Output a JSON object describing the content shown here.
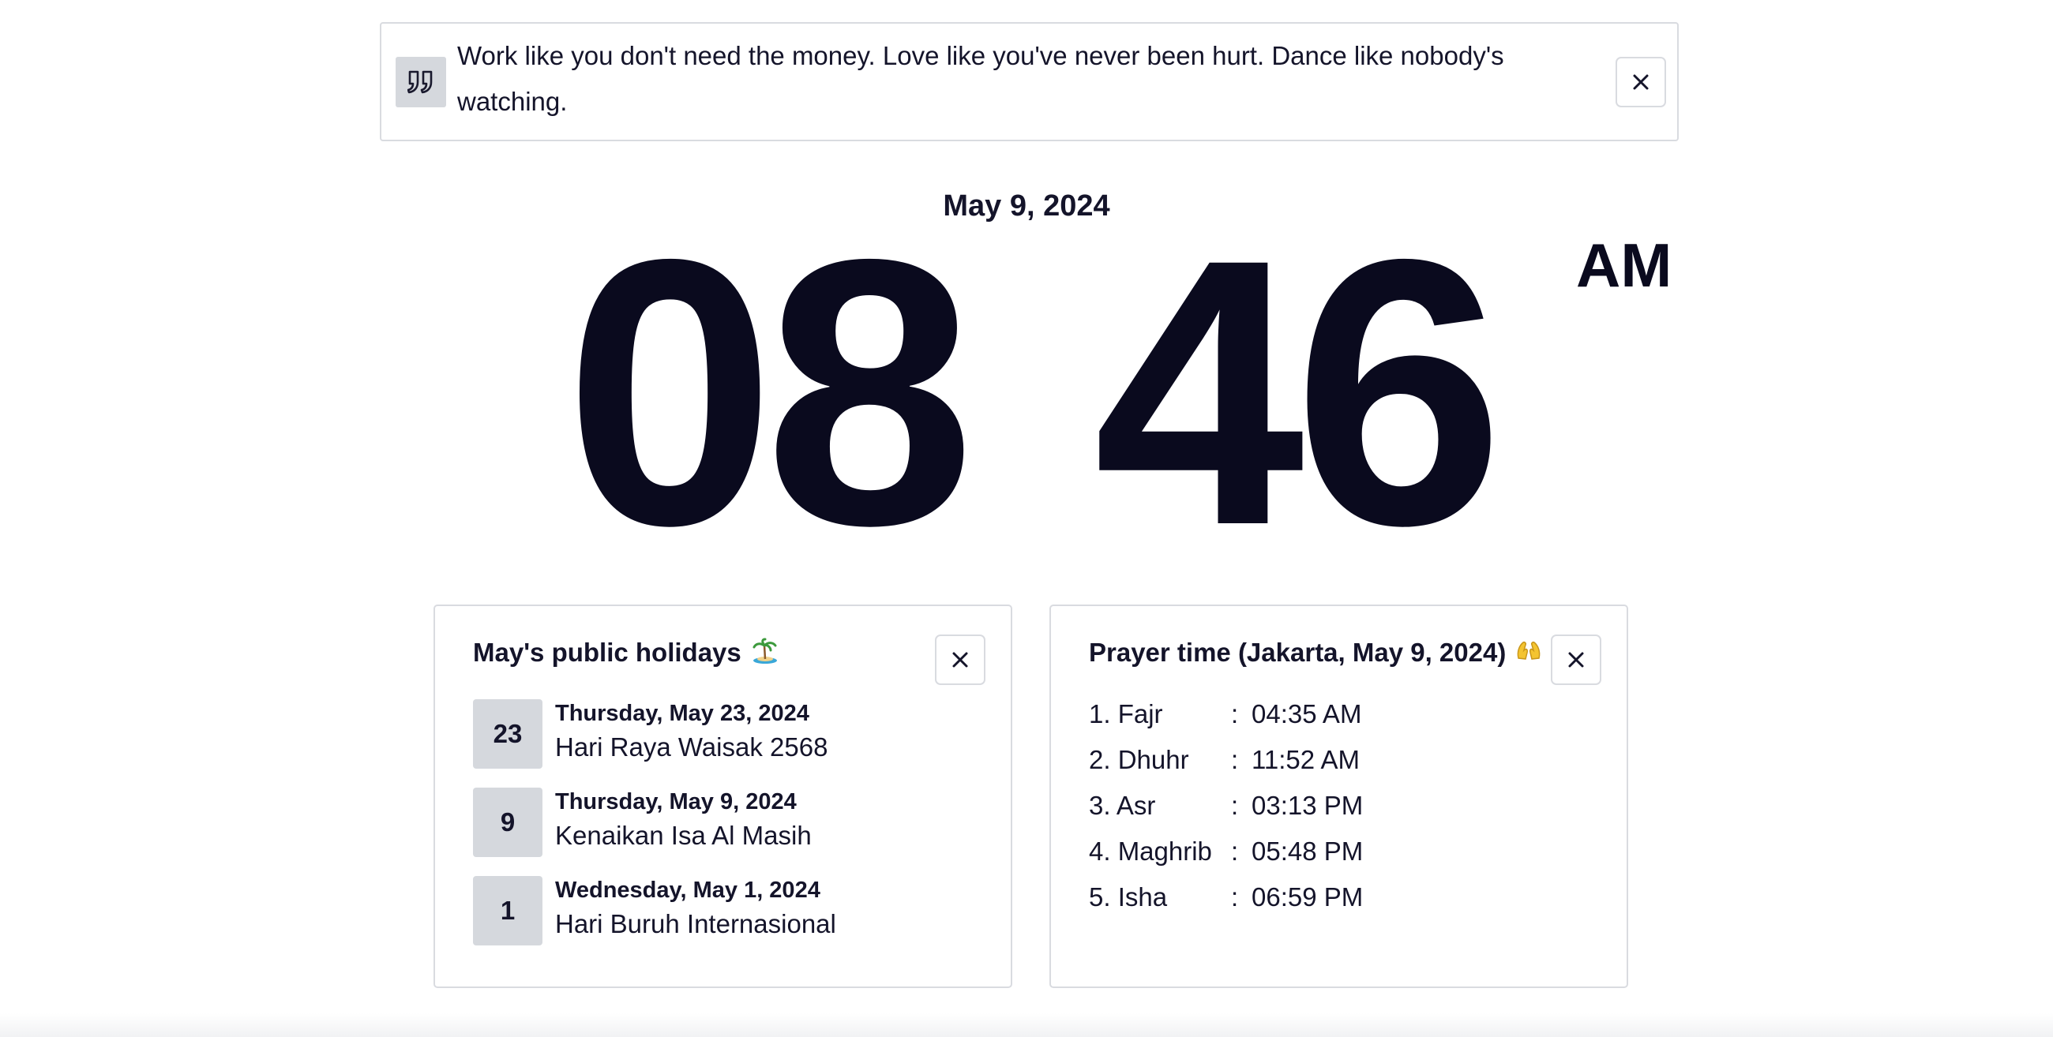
{
  "quote": {
    "text": "Work like you don't need the money. Love like you've never been hurt. Dance like nobody's watching.",
    "icon": "quote-icon",
    "close_icon": "close-icon"
  },
  "clock": {
    "date": "May 9, 2024",
    "hours": "08",
    "minutes": "46",
    "period": "AM"
  },
  "holidays": {
    "title": "May's public holidays",
    "title_icon": "island-icon",
    "items": [
      {
        "day": "23",
        "date": "Thursday, May 23, 2024",
        "name": "Hari Raya Waisak 2568"
      },
      {
        "day": "9",
        "date": "Thursday, May 9, 2024",
        "name": "Kenaikan Isa Al Masih"
      },
      {
        "day": "1",
        "date": "Wednesday, May 1, 2024",
        "name": "Hari Buruh Internasional"
      }
    ]
  },
  "prayer": {
    "title": "Prayer time (Jakarta, May 9, 2024)",
    "title_icon": "praying-hands-icon",
    "separator": ":",
    "items": [
      {
        "name": "1. Fajr",
        "time": "04:35 AM"
      },
      {
        "name": "2. Dhuhr",
        "time": "11:52 AM"
      },
      {
        "name": "3. Asr",
        "time": "03:13 PM"
      },
      {
        "name": "4. Maghrib",
        "time": "05:48 PM"
      },
      {
        "name": "5. Isha",
        "time": "06:59 PM"
      }
    ]
  },
  "colors": {
    "text": "#0a0a1e",
    "border": "#d9dbe0",
    "badge": "#d5d8dd"
  }
}
